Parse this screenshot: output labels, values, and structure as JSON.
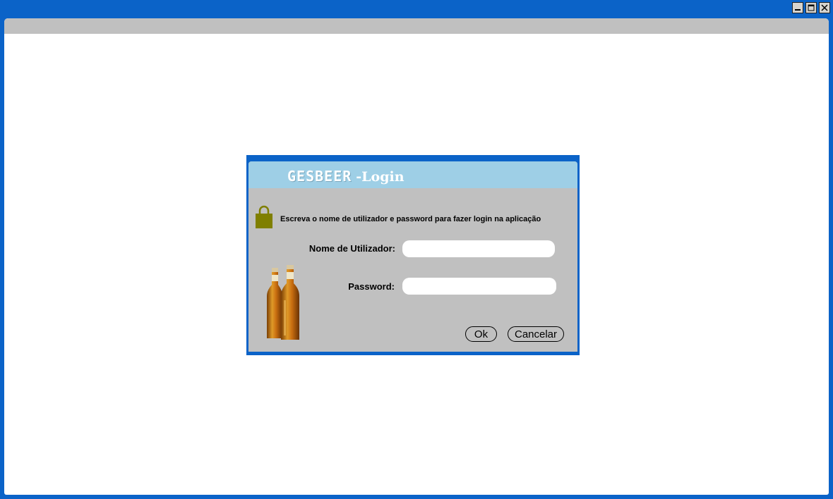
{
  "window": {
    "controls": [
      "minimize-icon",
      "maximize-icon",
      "close-icon"
    ]
  },
  "dialog": {
    "brand_name": "GESBEER",
    "brand_suffix": "-Login",
    "instructions": "Escreva o nome de utilizador e password para fazer login na aplicação",
    "username_label": "Nome de Utilizador:",
    "username_value": "",
    "password_label": "Password:",
    "password_value": "",
    "ok_label": "Ok",
    "cancel_label": "Cancelar"
  },
  "colors": {
    "window_frame": "#0b63c8",
    "header": "#9ecfe6",
    "panel": "#c0c0c0",
    "lock": "#7f7f00"
  }
}
